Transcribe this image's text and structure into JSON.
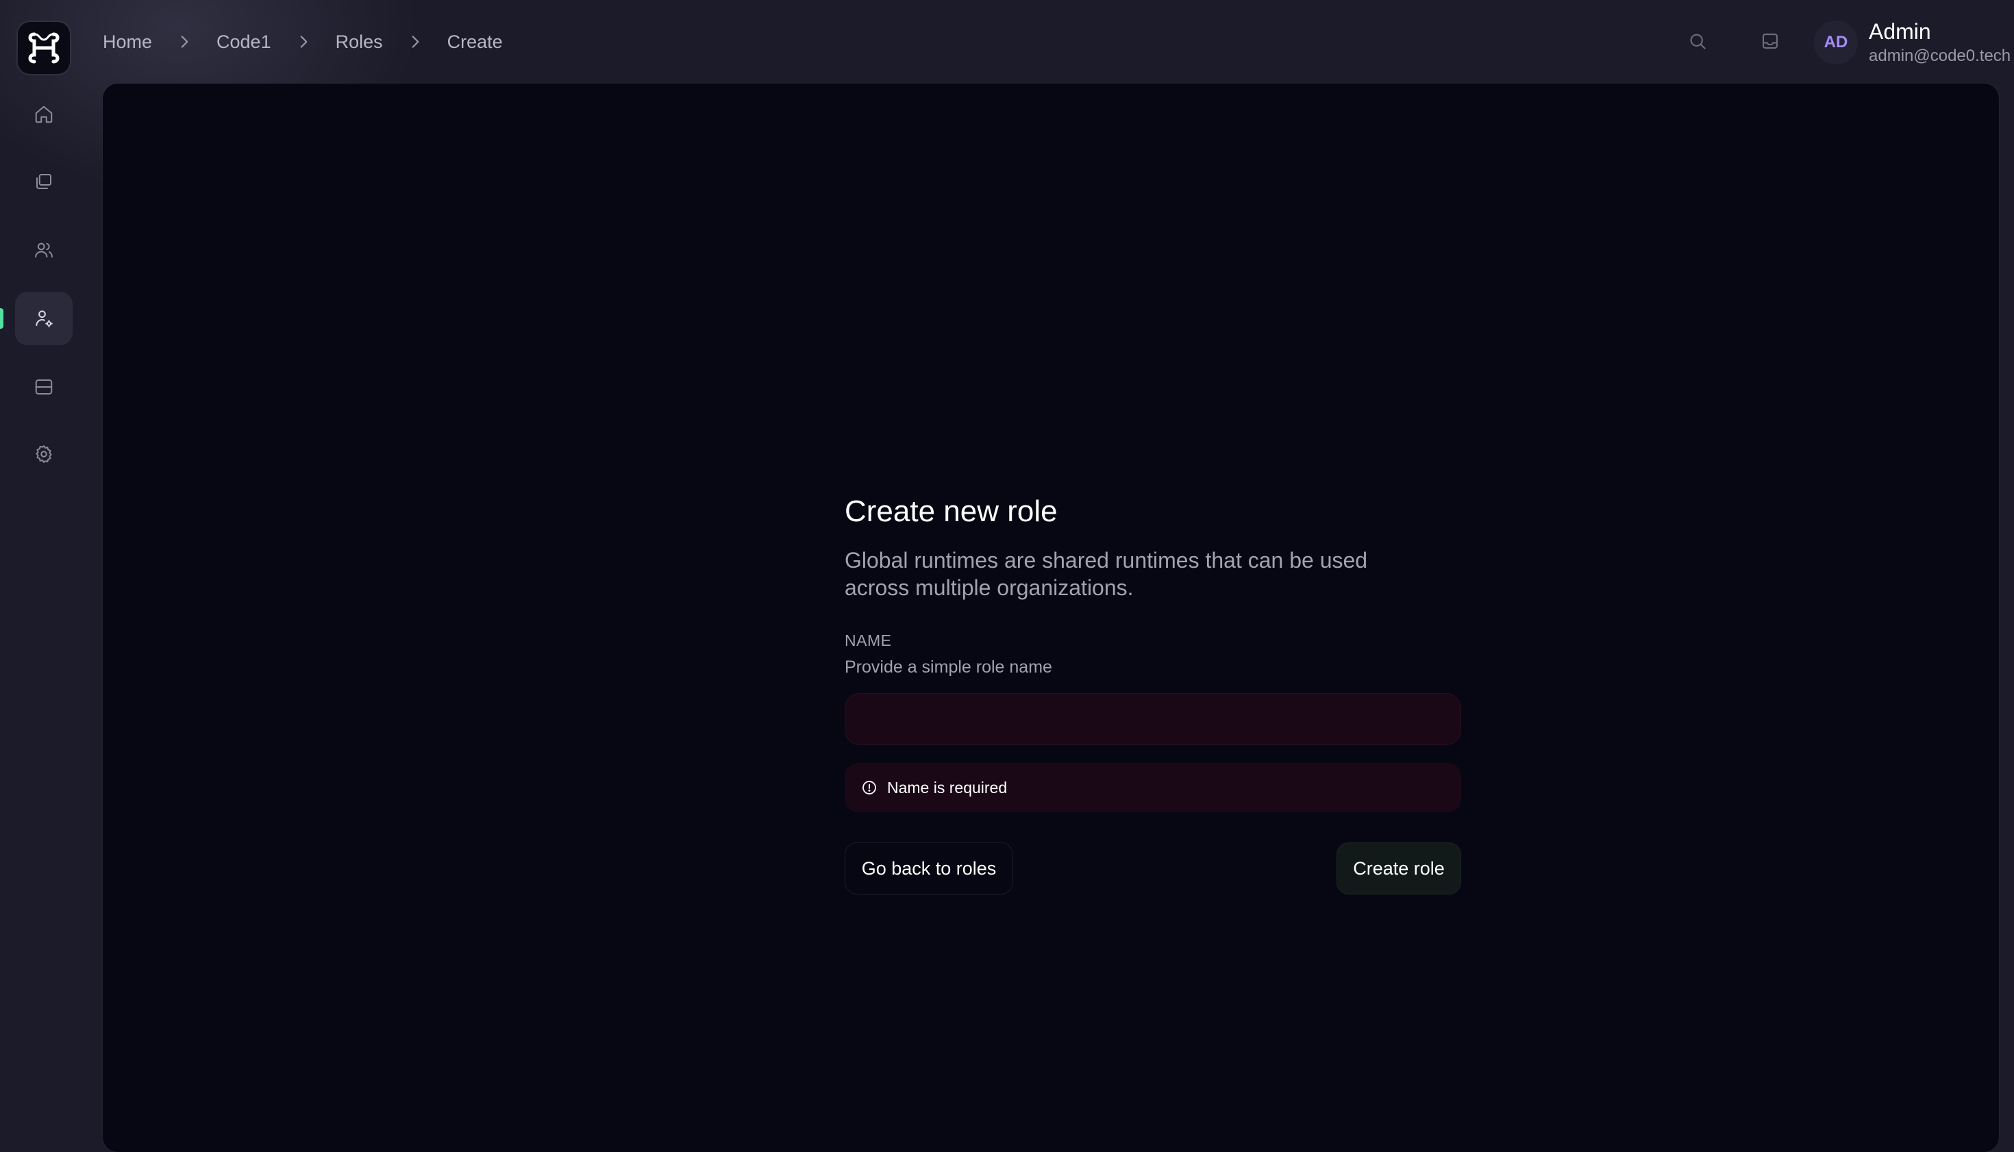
{
  "app": {
    "logo_icon": "code0-logo-icon"
  },
  "sidebar": {
    "items": [
      {
        "icon": "home-icon",
        "active": false
      },
      {
        "icon": "folders-icon",
        "active": false
      },
      {
        "icon": "users-icon",
        "active": false
      },
      {
        "icon": "user-cog-icon",
        "active": true
      },
      {
        "icon": "server-icon",
        "active": false
      },
      {
        "icon": "gear-icon",
        "active": false
      }
    ],
    "accent_color": "#54e0a0"
  },
  "header": {
    "breadcrumb": [
      "Home",
      "Code1",
      "Roles",
      "Create"
    ],
    "search_icon": "search-icon",
    "inbox_icon": "inbox-icon",
    "user": {
      "initials": "AD",
      "name": "Admin",
      "email": "admin@code0.tech"
    }
  },
  "form": {
    "title": "Create new role",
    "description": "Global runtimes are shared runtimes that can be used across multiple organizations.",
    "name_label": "NAME",
    "name_hint": "Provide a simple role name",
    "name_value": "",
    "error_message": "Name is required",
    "back_button": "Go back to roles",
    "create_button": "Create role"
  },
  "colors": {
    "background": "#1b1b29",
    "panel": "#070713",
    "error_bg": "#1b0816",
    "avatar_text": "#a78bfa"
  }
}
